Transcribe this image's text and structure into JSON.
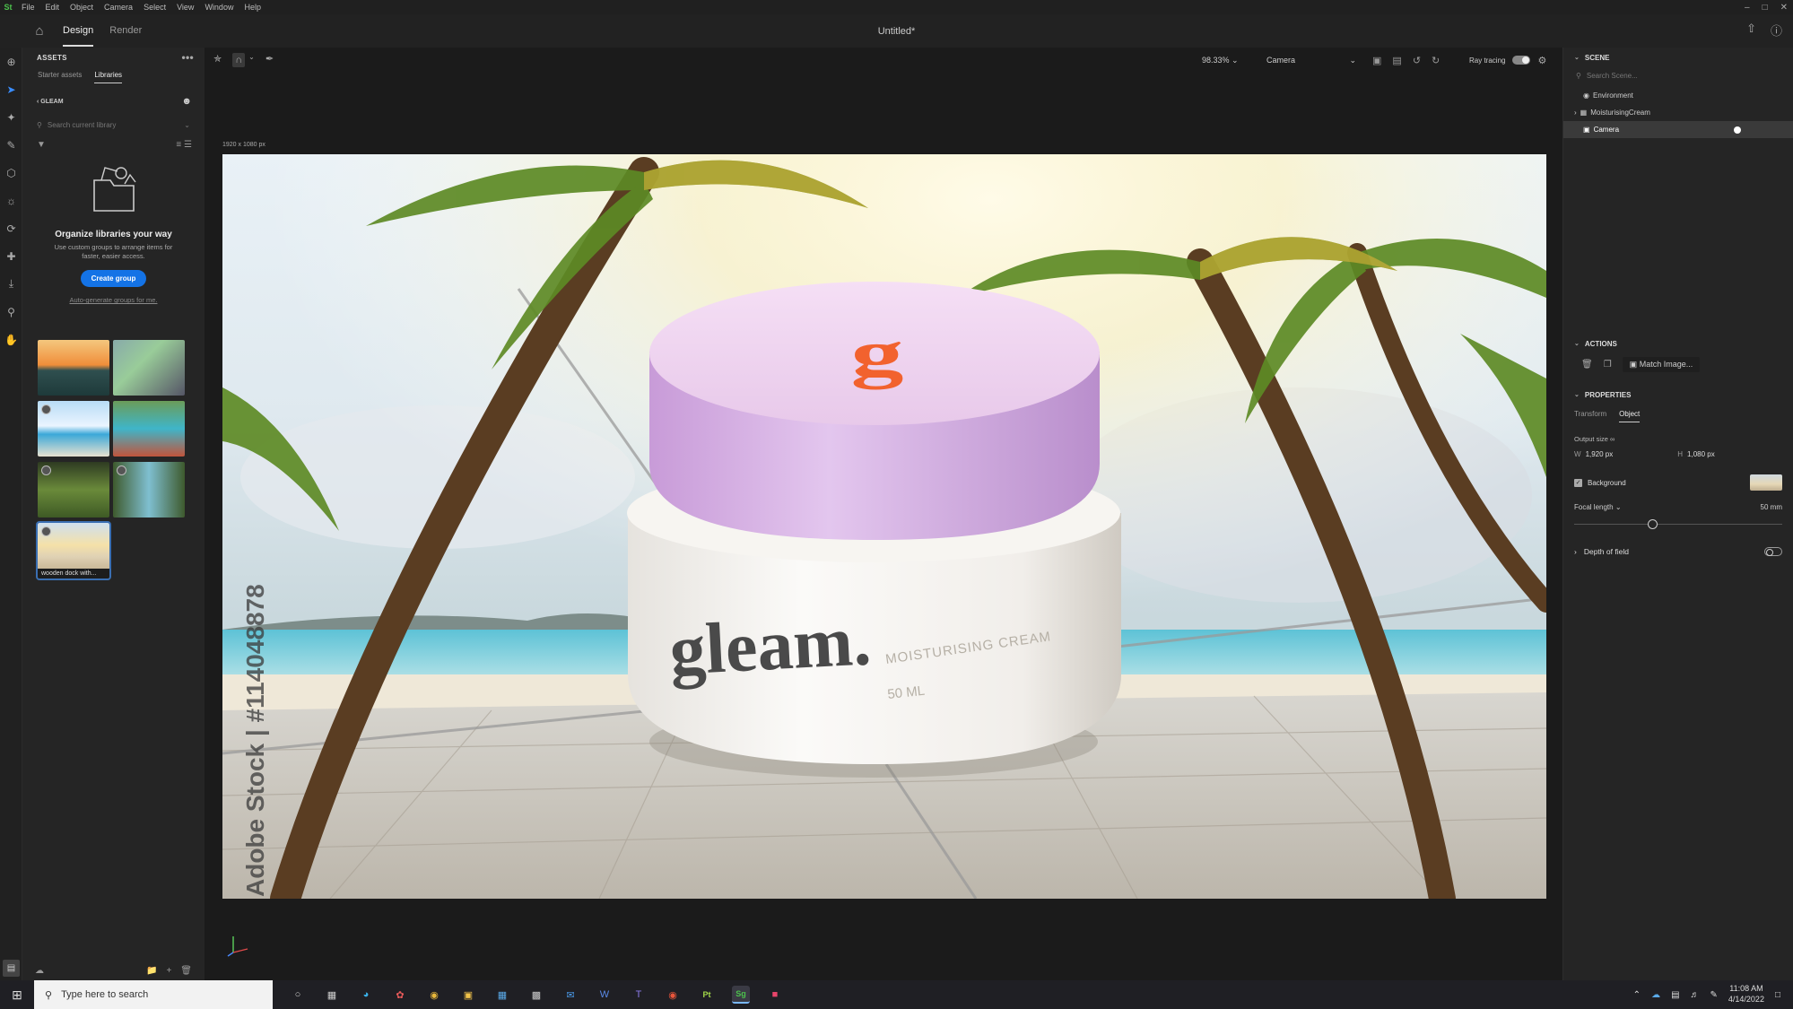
{
  "menubar": {
    "logo": "St",
    "items": [
      "File",
      "Edit",
      "Object",
      "Camera",
      "Select",
      "View",
      "Window",
      "Help"
    ]
  },
  "titlebar": {
    "tabs": [
      "Design",
      "Render"
    ],
    "active_tab": "Design",
    "document_title": "Untitled*"
  },
  "assets": {
    "header": "ASSETS",
    "subtabs": [
      "Starter assets",
      "Libraries"
    ],
    "active_subtab": "Libraries",
    "library_name": "GLEAM",
    "search_placeholder": "Search current library",
    "promo_title": "Organize libraries your way",
    "promo_text": "Use custom groups to arrange items for faster, easier access.",
    "create_group_label": "Create group",
    "auto_generate_label": "Auto-generate groups for me.",
    "selected_thumb_label": "wooden dock with..."
  },
  "toolbar": {
    "zoom": "98.33%",
    "camera": "Camera",
    "ray_tracing_label": "Ray tracing"
  },
  "canvas": {
    "dimensions": "1920 x 1080 px",
    "product": {
      "lid_logo": "g",
      "brand": "gleam.",
      "product_line": "MOISTURISING CREAM",
      "volume": "50 ML",
      "watermark": "Adobe Stock | #114048878"
    }
  },
  "scene_panel": {
    "header": "SCENE",
    "search_placeholder": "Search Scene...",
    "items": [
      "Environment",
      "MoisturisingCream",
      "Camera"
    ],
    "selected_item": "Camera"
  },
  "actions_panel": {
    "header": "ACTIONS",
    "match_image_label": "Match Image..."
  },
  "properties_panel": {
    "header": "PROPERTIES",
    "tabs": [
      "Transform",
      "Object"
    ],
    "active_tab": "Object",
    "output_size_label": "Output size",
    "width_label": "W",
    "width_value": "1,920 px",
    "height_label": "H",
    "height_value": "1,080 px",
    "background_label": "Background",
    "focal_length_label": "Focal length",
    "focal_length_value": "50 mm",
    "depth_of_field_label": "Depth of field"
  },
  "taskbar": {
    "search_placeholder": "Type here to search",
    "time": "11:08 AM",
    "date": "4/14/2022"
  },
  "colors": {
    "accent_blue": "#1473e6",
    "lid_pink": "#ddb7e6",
    "logo_orange": "#f2622e",
    "jar_white": "#f4f2ef"
  }
}
